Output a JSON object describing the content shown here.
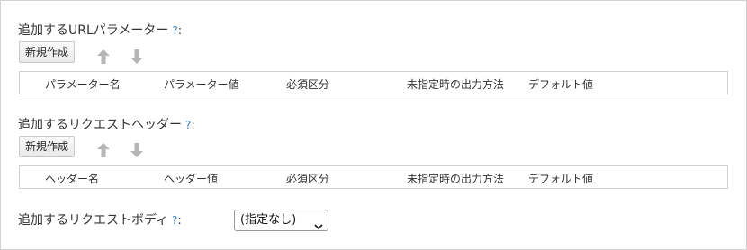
{
  "url_params": {
    "title": "追加するURLパラメーター",
    "help": "?",
    "colon": ":",
    "new_button": "新規作成",
    "icons": [
      "arrow-up-icon",
      "arrow-down-icon"
    ],
    "columns": [
      "パラメーター名",
      "パラメーター値",
      "必須区分",
      "未指定時の出力方法",
      "デフォルト値"
    ]
  },
  "headers": {
    "title": "追加するリクエストヘッダー",
    "help": "?",
    "colon": ":",
    "new_button": "新規作成",
    "icons": [
      "arrow-up-icon",
      "arrow-down-icon"
    ],
    "columns": [
      "ヘッダー名",
      "ヘッダー値",
      "必須区分",
      "未指定時の出力方法",
      "デフォルト値"
    ]
  },
  "body": {
    "title": "追加するリクエストボディ",
    "help": "?",
    "colon": ":",
    "select_value": "(指定なし)"
  },
  "colors": {
    "help_link": "#3a7fc1",
    "arrow_disabled": "#b5b5b5",
    "border": "#cfcfcf"
  }
}
